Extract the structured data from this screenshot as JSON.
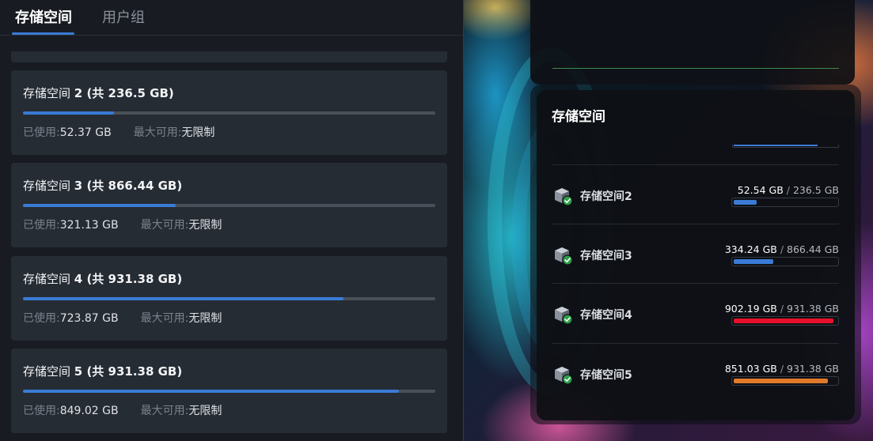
{
  "tabs": [
    {
      "label": "存储空间",
      "active": true
    },
    {
      "label": "用户组",
      "active": false
    }
  ],
  "volumes": [
    {
      "title_prefix": "存储空间 ",
      "number": "2",
      "total_text": " (共 236.5 GB)",
      "used_label": "已使用:",
      "used": "52.37 GB",
      "max_label": "最大可用:",
      "max": "无限制",
      "used_fraction": 0.221
    },
    {
      "title_prefix": "存储空间 ",
      "number": "3",
      "total_text": " (共 866.44 GB)",
      "used_label": "已使用:",
      "used": "321.13 GB",
      "max_label": "最大可用:",
      "max": "无限制",
      "used_fraction": 0.371
    },
    {
      "title_prefix": "存储空间 ",
      "number": "4",
      "total_text": " (共 931.38 GB)",
      "used_label": "已使用:",
      "used": "723.87 GB",
      "max_label": "最大可用:",
      "max": "无限制",
      "used_fraction": 0.777
    },
    {
      "title_prefix": "存储空间 ",
      "number": "5",
      "total_text": " (共 931.38 GB)",
      "used_label": "已使用:",
      "used": "849.02 GB",
      "max_label": "最大可用:",
      "max": "无限制",
      "used_fraction": 0.912
    }
  ],
  "widget": {
    "title": "存储空间",
    "top_stub_fraction": 0.8,
    "items": [
      {
        "name": "存储空间2",
        "used": "52.54 GB",
        "sep": " / ",
        "total": "236.5 GB",
        "fraction": 0.222,
        "color": "#3a7bd5"
      },
      {
        "name": "存储空间3",
        "used": "334.24 GB",
        "sep": " / ",
        "total": "866.44 GB",
        "fraction": 0.386,
        "color": "#3a7bd5"
      },
      {
        "name": "存储空间4",
        "used": "902.19 GB",
        "sep": " / ",
        "total": "931.38 GB",
        "fraction": 0.969,
        "color": "#e8102a"
      },
      {
        "name": "存储空间5",
        "used": "851.03 GB",
        "sep": " / ",
        "total": "931.38 GB",
        "fraction": 0.914,
        "color": "#e07a2a"
      }
    ]
  },
  "icons": {
    "volume": "disk-check-icon"
  }
}
